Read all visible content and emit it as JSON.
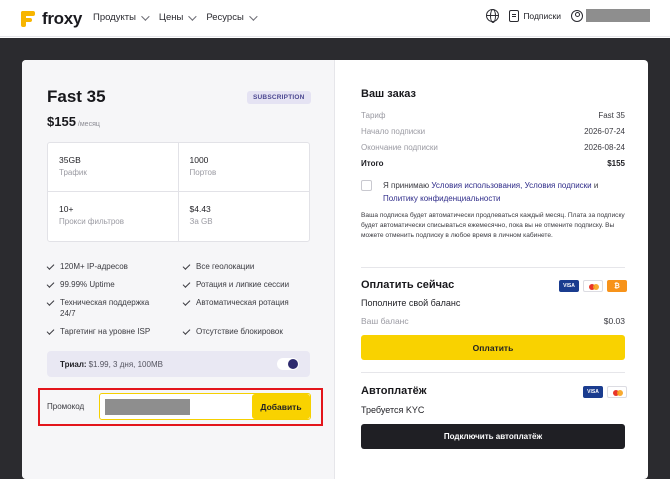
{
  "header": {
    "logo_text": "froxy",
    "nav": [
      {
        "label": "Продукты"
      },
      {
        "label": "Цены"
      },
      {
        "label": "Ресурсы"
      }
    ],
    "subscriptions_label": "Подписки"
  },
  "plan": {
    "title": "Fast 35",
    "badge": "SUBSCRIPTION",
    "price": "$155",
    "price_unit": "/месяц",
    "stats": [
      {
        "value": "35GB",
        "label": "Трафик"
      },
      {
        "value": "1000",
        "label": "Портов"
      },
      {
        "value": "10+",
        "label": "Прокси фильтров"
      },
      {
        "value": "$4.43",
        "label": "За GB"
      }
    ],
    "features": [
      "120M+ IP-адресов",
      "Все геолокации",
      "99.99% Uptime",
      "Ротация и липкие сессии",
      "Техническая поддержка 24/7",
      "Автоматическая ротация",
      "Таргетинг на уровне ISP",
      "Отсутствие блокировок"
    ],
    "trial_label": "Триал:",
    "trial_text": "$1.99, 3 дня, 100MB",
    "promo_label": "Промокод",
    "promo_button": "Добавить"
  },
  "order": {
    "title": "Ваш заказ",
    "rows": [
      {
        "label": "Тариф",
        "value": "Fast 35"
      },
      {
        "label": "Начало подписки",
        "value": "2026-07-24"
      },
      {
        "label": "Окончание подписки",
        "value": "2026-08-24"
      }
    ],
    "total_label": "Итого",
    "total_value": "$155",
    "agree_prefix": "Я принимаю",
    "agree_link1": "Условия использования, Условия подписки",
    "agree_and": "и",
    "agree_link2": "Политику конфиденциальности",
    "note": "Ваша подписка будет автоматически продлеваться каждый месяц. Плата за подписку будет автоматически списываться ежемесячно, пока вы не отмените подписку. Вы можете отменить подписку в любое время в личном кабинете.",
    "pay_title": "Оплатить сейчас",
    "topup": "Пополните свой баланс",
    "balance_label": "Ваш баланс",
    "balance_value": "$0.03",
    "pay_button": "Оплатить",
    "auto_title": "Автоплатёж",
    "kyc": "Требуется KYC",
    "auto_button": "Подключить автоплатёж",
    "visa": "VISA",
    "btc": "₿"
  }
}
